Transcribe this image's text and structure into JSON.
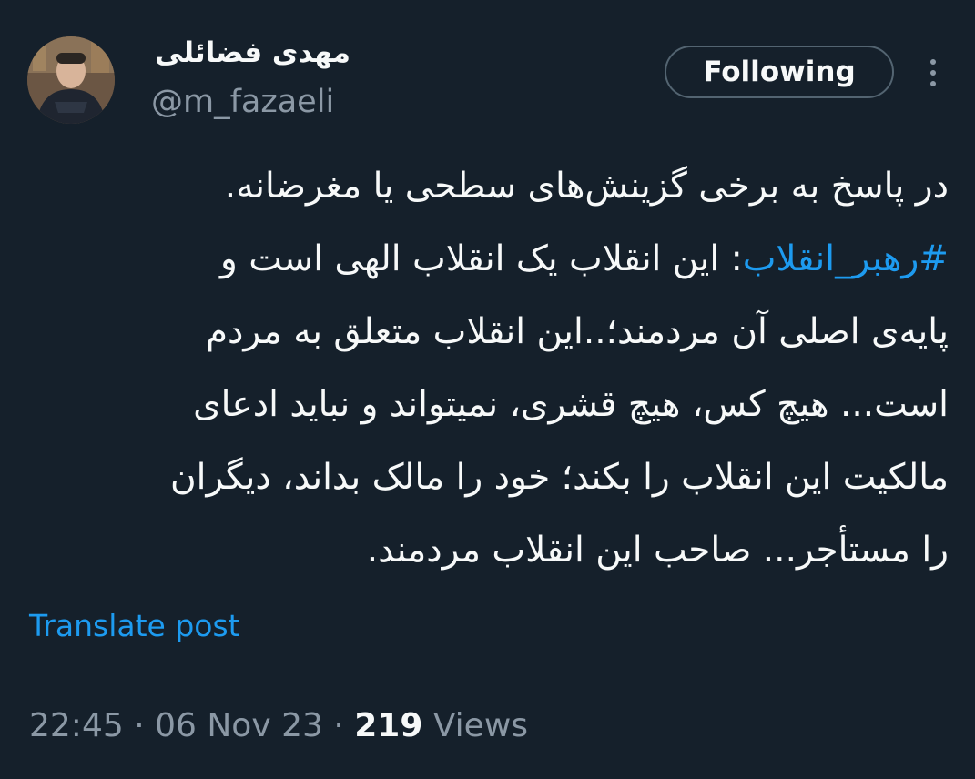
{
  "author": {
    "display_name": "مهدی فضائلی",
    "handle": "@m_fazaeli"
  },
  "follow_button": {
    "label": "Following"
  },
  "more_icon": "more-vertical-icon",
  "tweet": {
    "line1": "در پاسخ به برخی گزینش‌های سطحی یا مغرضانه.",
    "line2_hashtag": "#رهبر_انقلاب",
    "line2_rest": ": این انقلاب یک انقلاب الهی است و",
    "line3": "پایه‌ی اصلی آن مردمند؛..این انقلاب متعلق به مردم",
    "line4": "است... هیچ کس، هیچ قشری، نمیتواند و نباید ادعای",
    "line5": "مالکیت این انقلاب را بکند؛ خود را مالک بداند، دیگران",
    "line6": "را مستأجر... صاحب این انقلاب مردمند."
  },
  "translate_link": "Translate post",
  "meta": {
    "time": "22:45",
    "separator": "·",
    "date": "06 Nov 23",
    "views_count": "219",
    "views_label": "Views"
  },
  "colors": {
    "background": "#15202b",
    "link": "#1d9bf0",
    "secondary_text": "#8b98a5"
  }
}
